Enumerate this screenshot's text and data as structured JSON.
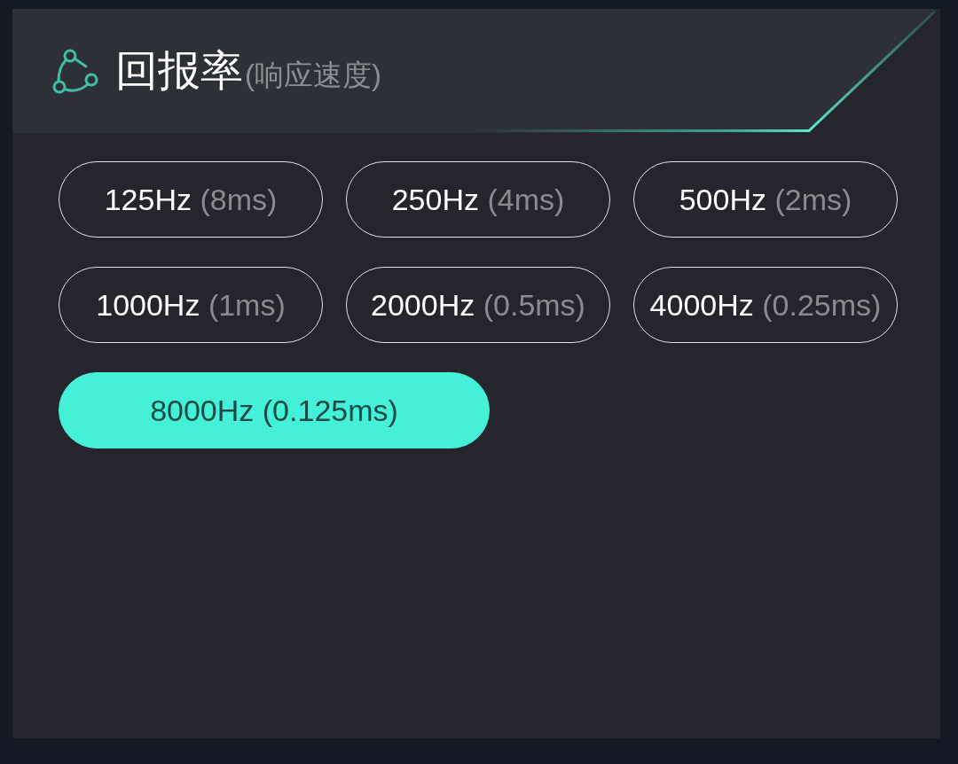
{
  "panel": {
    "title": "回报率",
    "subtitle": "(响应速度)"
  },
  "options": [
    {
      "rate": "125Hz",
      "interval": "(8ms)",
      "selected": false,
      "kind": "standard"
    },
    {
      "rate": "250Hz",
      "interval": "(4ms)",
      "selected": false,
      "kind": "standard"
    },
    {
      "rate": "500Hz",
      "interval": "(2ms)",
      "selected": false,
      "kind": "standard"
    },
    {
      "rate": "1000Hz",
      "interval": "(1ms)",
      "selected": false,
      "kind": "standard"
    },
    {
      "rate": "2000Hz",
      "interval": "(0.5ms)",
      "selected": false,
      "kind": "standard"
    },
    {
      "rate": "4000Hz",
      "interval": "(0.25ms)",
      "selected": false,
      "kind": "standard"
    },
    {
      "rate": "8000Hz",
      "interval": "(0.125ms)",
      "selected": true,
      "kind": "wide"
    }
  ]
}
